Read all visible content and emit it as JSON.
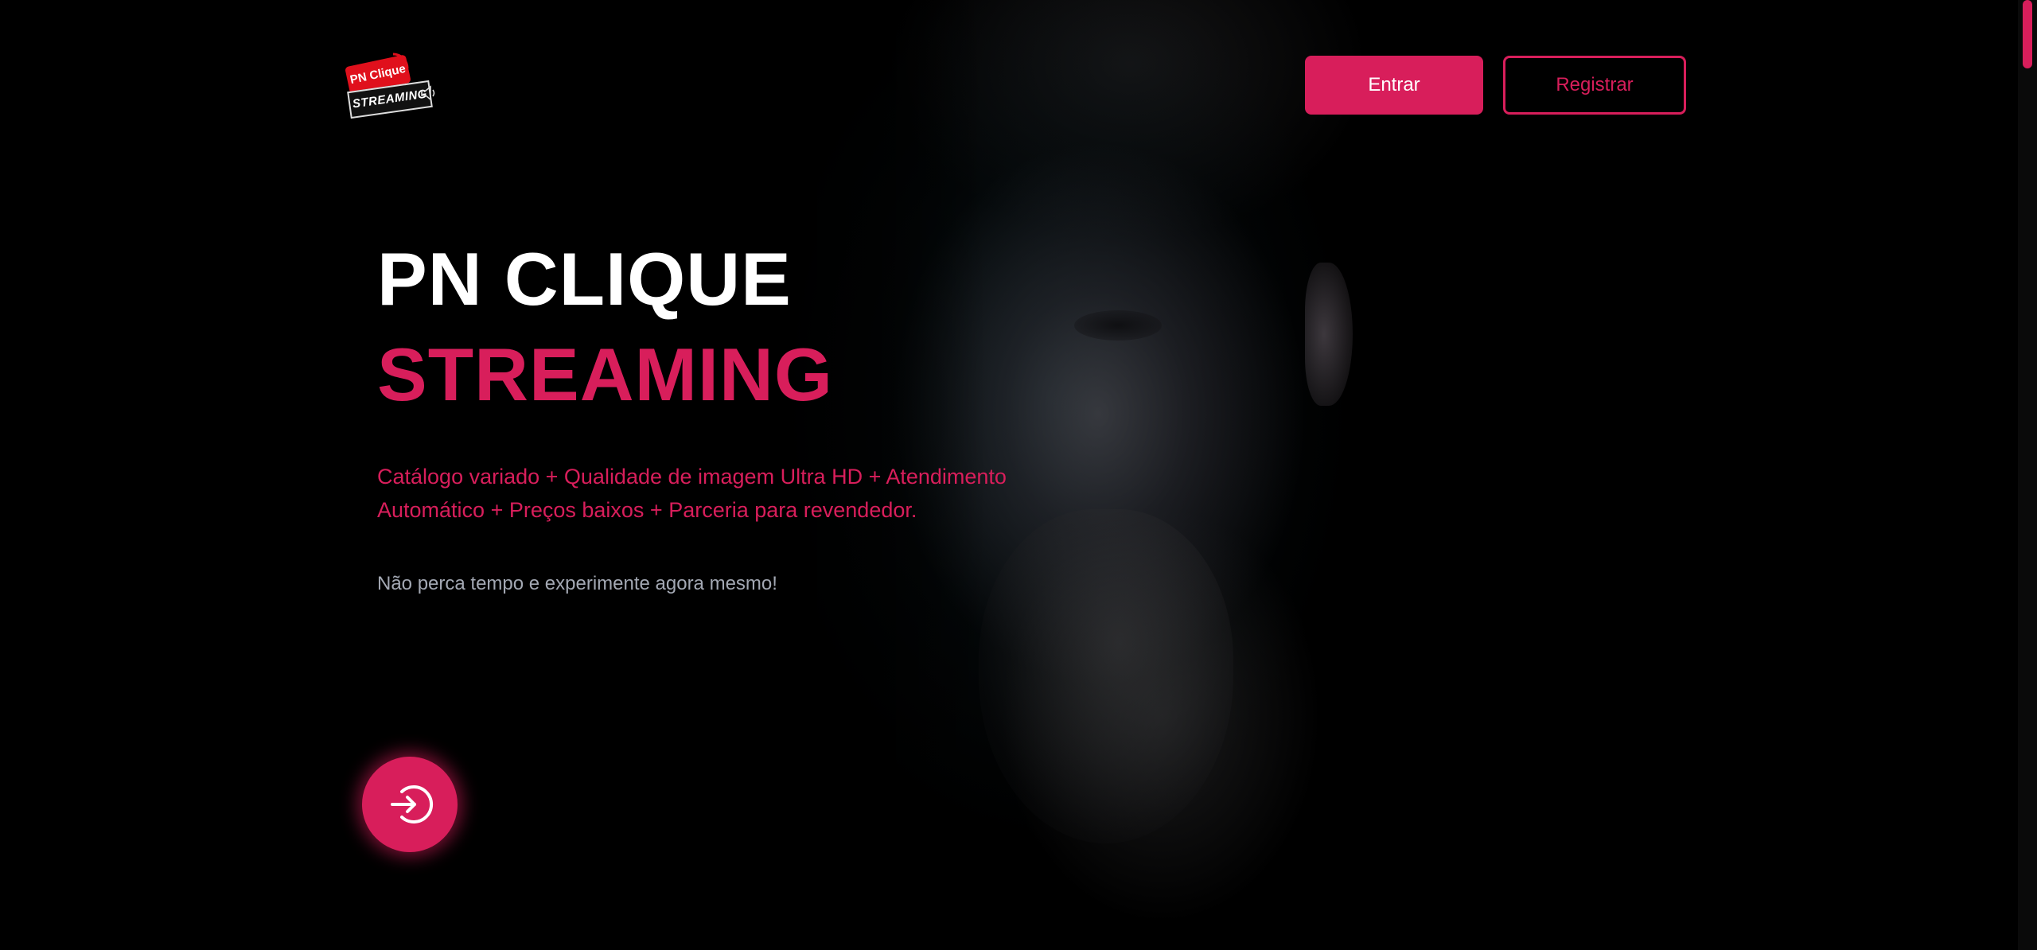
{
  "brand": {
    "logo_top_text": "PN Clique",
    "logo_bottom_text": "STREAMING",
    "accent_color": "#d81e5b"
  },
  "header": {
    "login_label": "Entrar",
    "register_label": "Registrar"
  },
  "hero": {
    "title_line1": "PN CLIQUE",
    "title_line2": "STREAMING",
    "description": "Catálogo variado + Qualidade de imagem Ultra HD + Atendimento Automático + Preços baixos + Parceria para revendedor.",
    "cta_text": "Não perca tempo e experimente agora mesmo!",
    "round_button_icon": "login-icon"
  }
}
